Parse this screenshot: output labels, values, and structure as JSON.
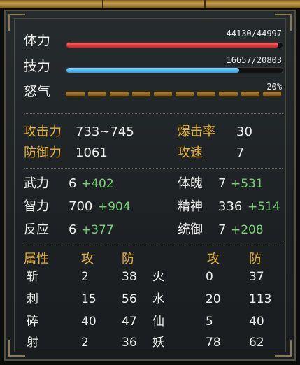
{
  "vitals": {
    "hp": {
      "label": "体力",
      "value": "44130/44997",
      "ratio": 0.9807
    },
    "mp": {
      "label": "技力",
      "value": "16657/20803",
      "ratio": 0.8007
    },
    "rage": {
      "label": "怒气",
      "value": "20%",
      "segments": 10
    }
  },
  "combat": {
    "attack_label": "攻击力",
    "attack_value": "733~745",
    "crit_label": "爆击率",
    "crit_value": "30",
    "defense_label": "防御力",
    "defense_value": "1061",
    "speed_label": "攻速",
    "speed_value": "7"
  },
  "attributes": [
    {
      "label": "武力",
      "base": "6",
      "bonus": "+402"
    },
    {
      "label": "体魄",
      "base": "7",
      "bonus": "+531"
    },
    {
      "label": "智力",
      "base": "700",
      "bonus": "+904"
    },
    {
      "label": "精神",
      "base": "336",
      "bonus": "+514"
    },
    {
      "label": "反应",
      "base": "6",
      "bonus": "+377"
    },
    {
      "label": "统御",
      "base": "7",
      "bonus": "+208"
    }
  ],
  "resist": {
    "header_attr": "属性",
    "header_atk": "攻",
    "header_def": "防",
    "left": [
      {
        "name": "斩",
        "atk": "2",
        "def": "38"
      },
      {
        "name": "刺",
        "atk": "15",
        "def": "56"
      },
      {
        "name": "碎",
        "atk": "40",
        "def": "47"
      },
      {
        "name": "射",
        "atk": "2",
        "def": "36"
      }
    ],
    "right": [
      {
        "name": "火",
        "atk": "0",
        "def": "37"
      },
      {
        "name": "水",
        "atk": "20",
        "def": "113"
      },
      {
        "name": "仙",
        "atk": "5",
        "def": "40"
      },
      {
        "name": "妖",
        "atk": "78",
        "def": "62"
      }
    ]
  }
}
